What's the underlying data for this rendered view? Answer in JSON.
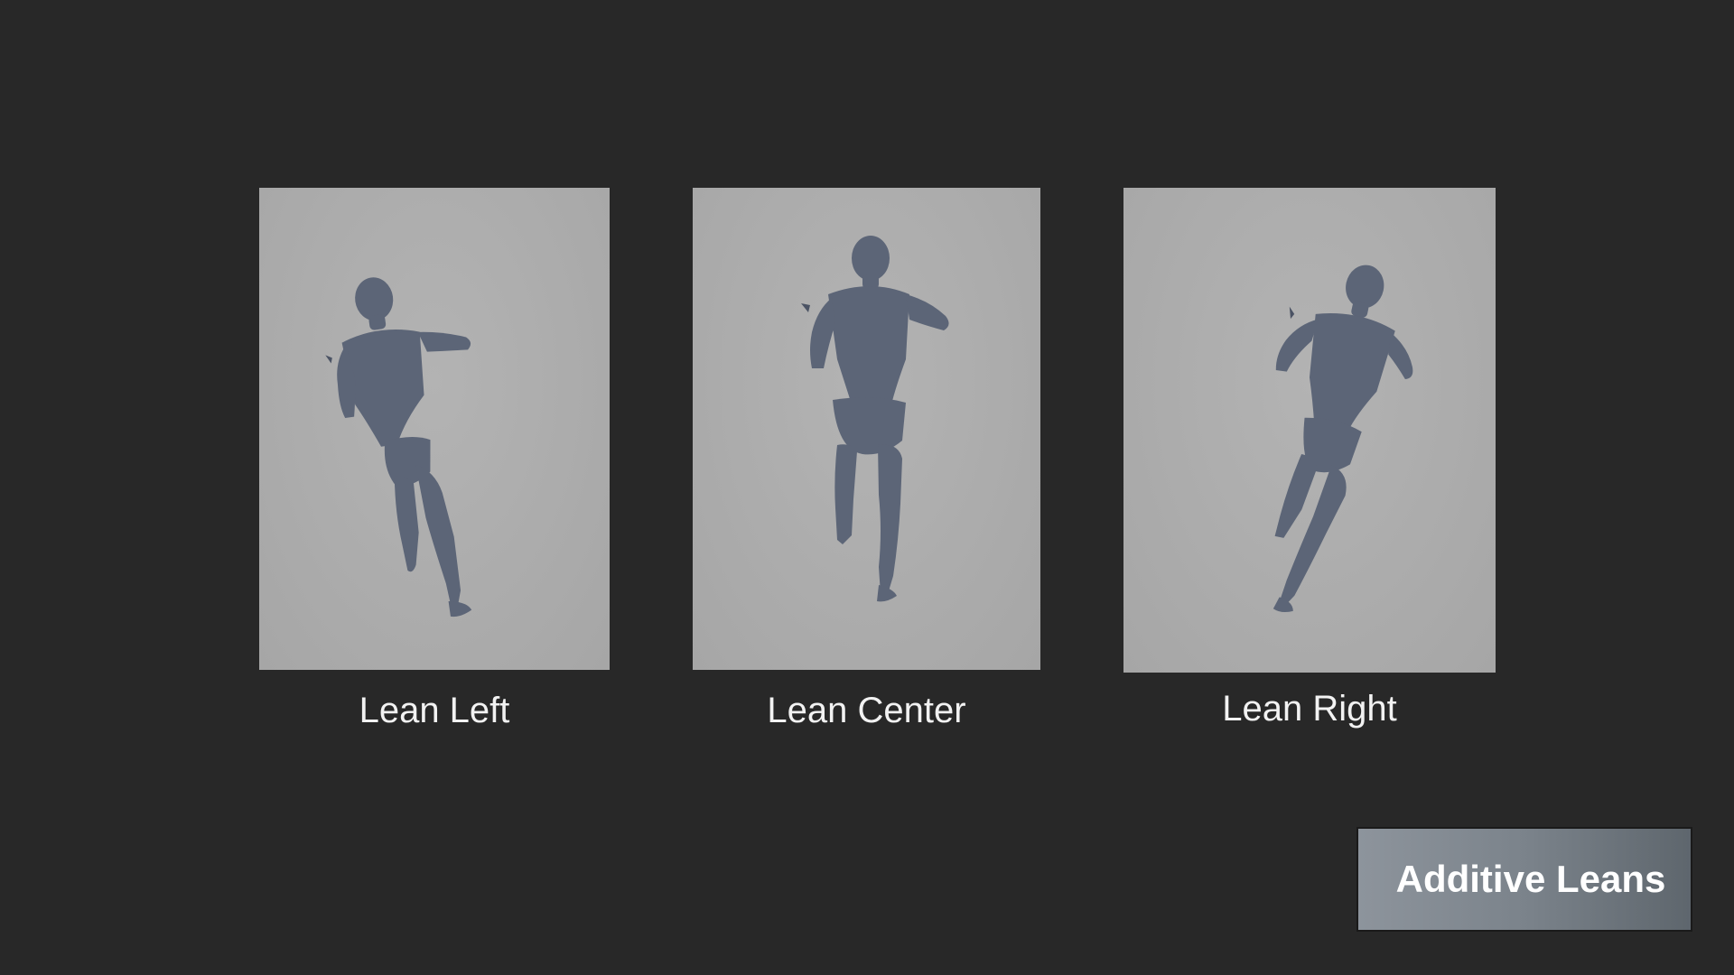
{
  "panels": [
    {
      "id": "left",
      "label": "Lean Left",
      "figure": "runner-lean-left"
    },
    {
      "id": "center",
      "label": "Lean Center",
      "figure": "runner-lean-center"
    },
    {
      "id": "right",
      "label": "Lean Right",
      "figure": "runner-lean-right"
    }
  ],
  "badge": {
    "label": "Additive Leans"
  },
  "colors": {
    "background": "#282828",
    "panel": "#aaaaaa",
    "figure": "#5c6577",
    "caption": "#f2f2f2",
    "badge_text": "#ffffff"
  }
}
